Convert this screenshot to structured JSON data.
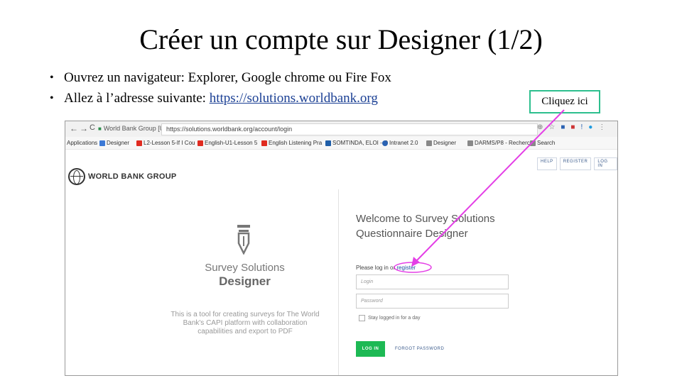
{
  "slide": {
    "title": "Créer un compte sur Designer (1/2)",
    "bullets": [
      {
        "text": "Ouvrez un navigateur: Explorer, Google chrome ou Fire Fox"
      },
      {
        "text_before": "Allez à l’adresse suivante: ",
        "link": "https://solutions.worldbank.org"
      }
    ],
    "callout": "Cliquez ici",
    "bullet_marker": "•"
  },
  "browser": {
    "nav": {
      "back": "←",
      "forward": "→",
      "reload": "C"
    },
    "site_identity": "World Bank Group [US]",
    "url": "https://solutions.worldbank.org/account/login",
    "bookmarks": [
      {
        "label": "Applications",
        "color": "#3c79d6"
      },
      {
        "label": "Designer",
        "color": "#3c79d6"
      },
      {
        "label": "L2-Lesson 5-If I Cou",
        "color": "#e02b20"
      },
      {
        "label": "English-U1-Lesson 5",
        "color": "#e02b20"
      },
      {
        "label": "English Listening Pra",
        "color": "#e02b20"
      },
      {
        "label": "SOMTINDA, ELOI - O",
        "color": "#1f5ea8"
      },
      {
        "label": "Intranet 2.0",
        "color": "#2a62b2"
      },
      {
        "label": "Designer",
        "color": "#666666"
      },
      {
        "label": "DARMS/P8 - Recherc",
        "color": "#666666"
      },
      {
        "label": "Search",
        "color": "#666666"
      }
    ]
  },
  "page": {
    "top_links": [
      "HELP",
      "REGISTER",
      "LOG IN"
    ],
    "logo_text": "WORLD BANK GROUP",
    "product_line1": "Survey Solutions",
    "product_line2": "Designer",
    "description": "This is a tool for creating surveys for The World Bank's CAPI platform with collaboration capabilities and export to PDF",
    "welcome_line1": "Welcome to Survey Solutions",
    "welcome_line2": "Questionnaire Designer",
    "login_prompt": "Please log in or",
    "register_link": "register",
    "login_placeholder": "Login",
    "password_placeholder": "Password",
    "stay_logged": "Stay logged in for a day",
    "login_button": "LOG IN",
    "forgot_password": "FORGOT PASSWORD"
  },
  "colors": {
    "arrow": "#e43fe6",
    "callout_border": "#2dbf8e",
    "login_button": "#1db954"
  }
}
